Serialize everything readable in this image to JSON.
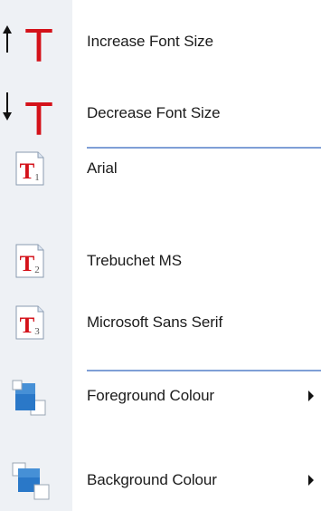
{
  "menu": {
    "items": [
      {
        "label": "Increase Font Size",
        "icon": "increase-font-size-icon"
      },
      {
        "label": "Decrease Font Size",
        "icon": "decrease-font-size-icon"
      },
      {
        "label": "Arial",
        "icon": "font-1-icon",
        "icon_digit": "1"
      },
      {
        "label": "Trebuchet MS",
        "icon": "font-2-icon",
        "icon_digit": "2"
      },
      {
        "label": "Microsoft Sans Serif",
        "icon": "font-3-icon",
        "icon_digit": "3"
      },
      {
        "label": "Foreground Colour",
        "icon": "foreground-colour-icon",
        "has_submenu": true
      },
      {
        "label": "Background Colour",
        "icon": "background-colour-icon",
        "has_submenu": true
      }
    ],
    "icon_glyph": "T",
    "colors": {
      "accent_red": "#d4121a",
      "separator": "#7f9fd6",
      "swatch_blue": "#2a78c8"
    }
  }
}
